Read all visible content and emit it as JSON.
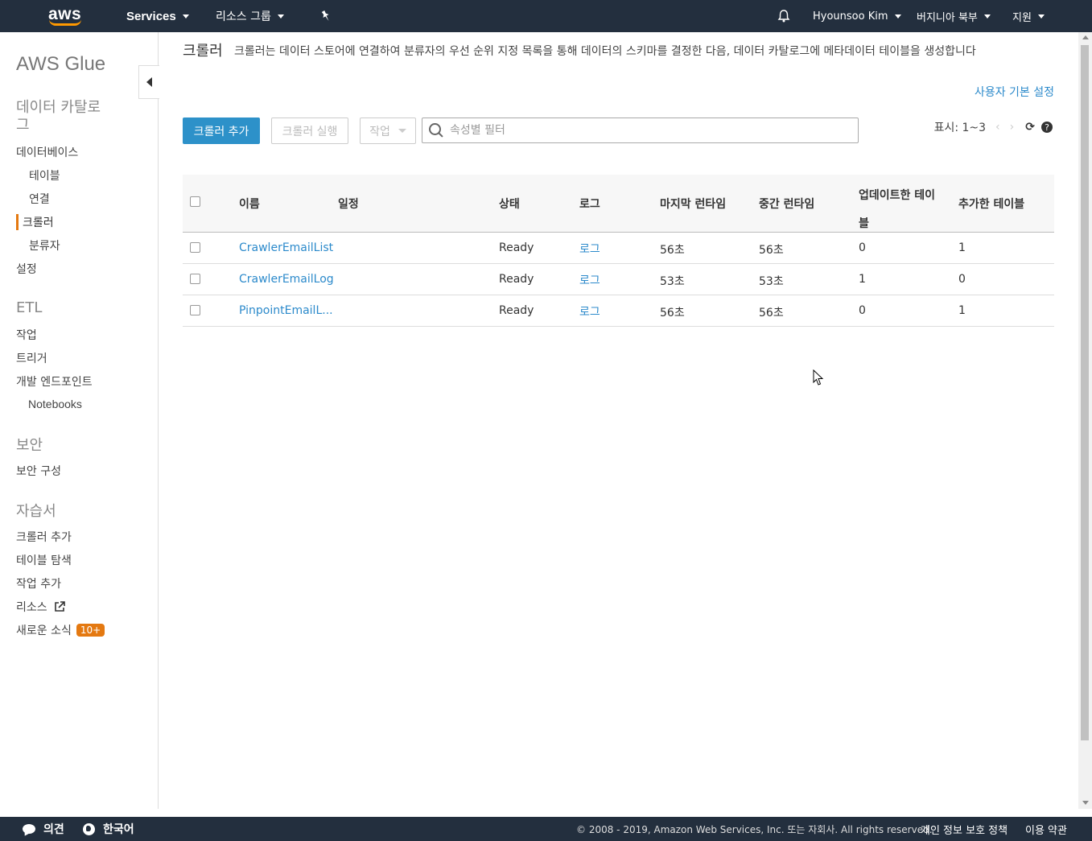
{
  "topnav": {
    "logo_text": "aws",
    "services": "Services",
    "resource_groups": "리소스 그룹",
    "user": "Hyounsoo Kim",
    "region": "버지니아 북부",
    "support": "지원"
  },
  "sidebar": {
    "title": "AWS Glue",
    "catalog_heading_line1": "데이터 카탈로",
    "catalog_heading_line2": "그",
    "databases": "데이터베이스",
    "tables": "테이블",
    "connections": "연결",
    "crawlers": "크롤러",
    "classifiers": "분류자",
    "settings": "설정",
    "etl_heading": "ETL",
    "jobs": "작업",
    "triggers": "트리거",
    "dev_endpoints": "개발 엔드포인트",
    "notebooks": "Notebooks",
    "security_heading": "보안",
    "security_config": "보안 구성",
    "tutorials_heading": "자습서",
    "tut_add_crawler": "크롤러 추가",
    "tut_explore_table": "테이블 탐색",
    "tut_add_job": "작업 추가",
    "resources": "리소스",
    "whats_new": "새로운 소식",
    "whats_new_badge": "10+"
  },
  "main": {
    "title": "크롤러",
    "description": "크롤러는 데이터 스토어에 연결하여 분류자의 우선 순위 지정 목록을 통해 데이터의 스키마를 결정한 다음, 데이터 카탈로그에 메타데이터 테이블을 생성합니다",
    "prefs_link": "사용자 기본 설정",
    "add_crawler": "크롤러 추가",
    "run_crawler": "크롤러 실행",
    "action": "작업",
    "search_placeholder": "속성별 필터",
    "pager_text": "표시: 1~3",
    "pager_prev": "‹",
    "pager_next": "›",
    "refresh_icon": "⟳",
    "help_icon": "?"
  },
  "table": {
    "headers": {
      "name": "이름",
      "schedule": "일정",
      "status": "상태",
      "logs": "로그",
      "last_runtime": "마지막 런타임",
      "median_runtime": "중간 런타임",
      "tables_updated_line1": "업데이트한 테이",
      "tables_updated_line2": "블",
      "tables_added": "추가한 테이블"
    },
    "rows": [
      {
        "name": "CrawlerEmailList",
        "schedule": "",
        "status": "Ready",
        "logs": "로그",
        "last_runtime": "56초",
        "median_runtime": "56초",
        "updated": "0",
        "added": "1"
      },
      {
        "name": "CrawlerEmailLog",
        "schedule": "",
        "status": "Ready",
        "logs": "로그",
        "last_runtime": "53초",
        "median_runtime": "53초",
        "updated": "1",
        "added": "0"
      },
      {
        "name": "PinpointEmailL...",
        "schedule": "",
        "status": "Ready",
        "logs": "로그",
        "last_runtime": "56초",
        "median_runtime": "56초",
        "updated": "0",
        "added": "1"
      }
    ]
  },
  "footer": {
    "feedback": "의견",
    "language": "한국어",
    "copyright": "© 2008 - 2019, Amazon Web Services, Inc. 또는 자회사. All rights reserved.",
    "privacy": "개인 정보 보호 정책",
    "terms": "이용 약관"
  }
}
